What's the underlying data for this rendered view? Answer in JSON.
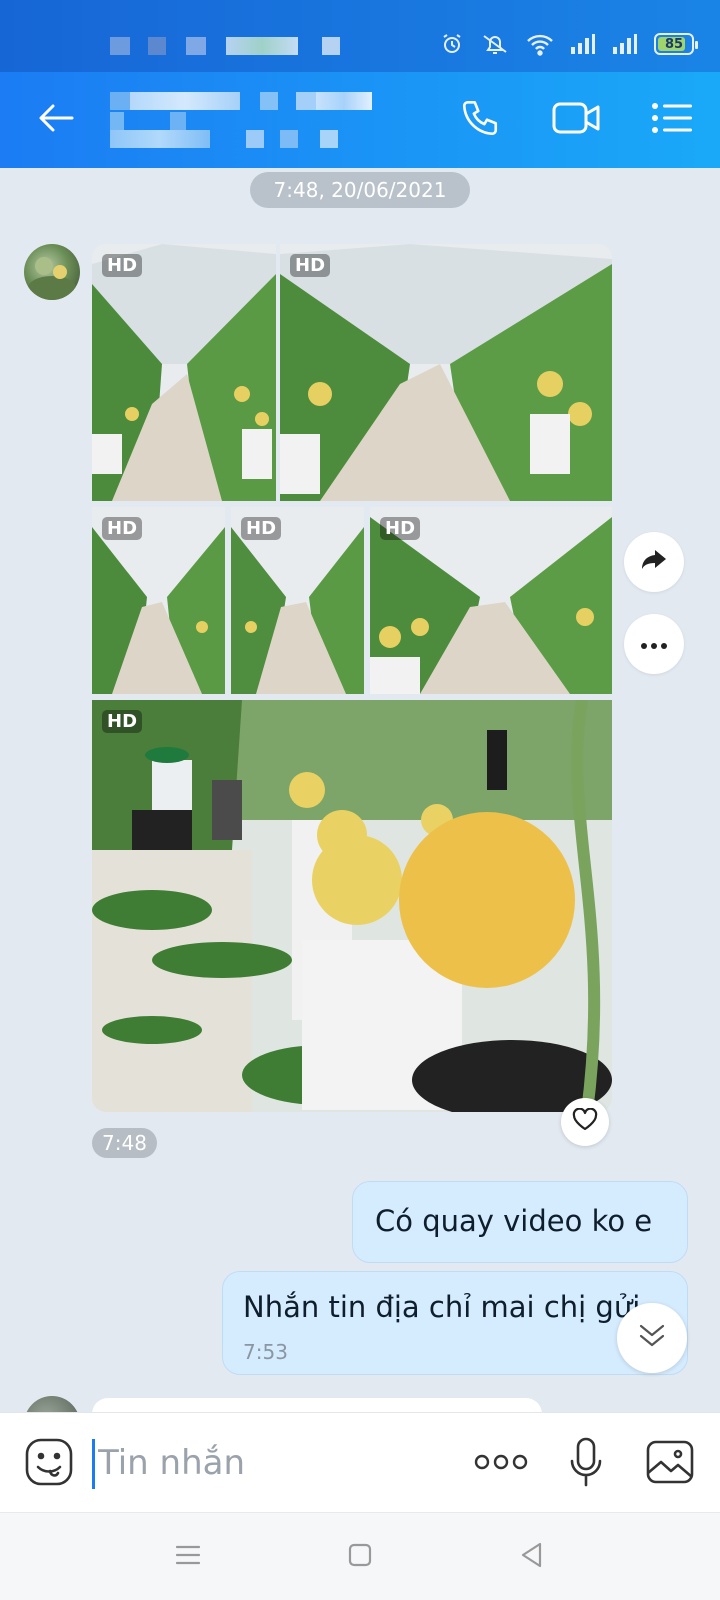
{
  "status_bar": {
    "battery": "85",
    "battery_level": 0.85
  },
  "header": {
    "back_icon": "arrow-left-icon",
    "call_icon": "phone-icon",
    "video_icon": "video-camera-icon",
    "menu_icon": "list-menu-icon"
  },
  "conversation": {
    "date_separator": "7:48, 20/06/2021",
    "photo_message": {
      "badges": [
        "HD",
        "HD",
        "HD",
        "HD",
        "HD",
        "HD"
      ],
      "time": "7:48"
    },
    "outgoing": [
      {
        "text": "Có quay video ko e"
      },
      {
        "text": "Nhắn tin địa chỉ mai chị gửi",
        "time": "7:53"
      }
    ]
  },
  "input": {
    "placeholder": "Tin nhắn"
  },
  "colors": {
    "header": "#1a8ff5",
    "bubble": "#d5ecfe",
    "caret": "#1a7cf3"
  }
}
